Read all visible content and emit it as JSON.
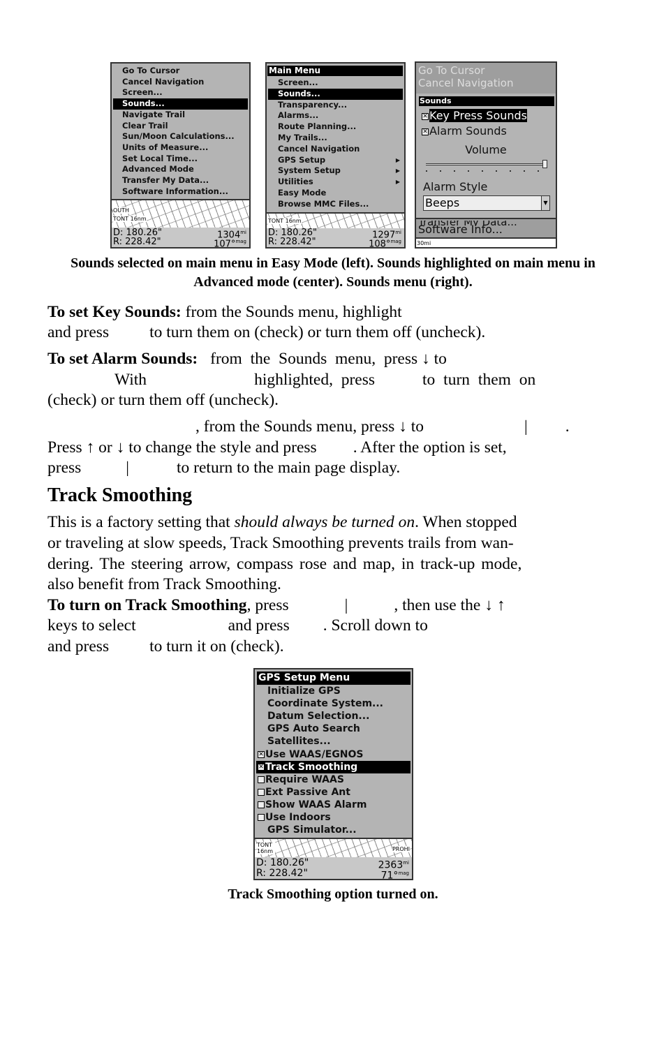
{
  "screen_easy": {
    "items": [
      "Go To Cursor",
      "Cancel Navigation",
      "Screen...",
      "Sounds...",
      "Navigate Trail",
      "Clear Trail",
      "Sun/Moon Calculations...",
      "Units of Measure...",
      "Set Local Time...",
      "Advanced Mode",
      "Transfer My Data...",
      "Software Information..."
    ],
    "selected": "Sounds...",
    "map_labels": [
      "OUTH",
      "TONT 16nm"
    ],
    "d": "D:  180.26\"",
    "r": "R:  228.42\"",
    "dist": "1304",
    "dist_unit": "mi",
    "bearing": "107°",
    "bearing_unit": "mag"
  },
  "screen_adv": {
    "title": "Main Menu",
    "items": [
      {
        "label": "Screen..."
      },
      {
        "label": "Sounds..."
      },
      {
        "label": "Transparency..."
      },
      {
        "label": "Alarms..."
      },
      {
        "label": "Route Planning..."
      },
      {
        "label": "My Trails..."
      },
      {
        "label": "Cancel Navigation"
      },
      {
        "label": "GPS Setup",
        "arrow": true
      },
      {
        "label": "System Setup",
        "arrow": true
      },
      {
        "label": "Utilities",
        "arrow": true
      },
      {
        "label": "Easy Mode"
      },
      {
        "label": "Browse MMC Files..."
      }
    ],
    "selected": "Sounds...",
    "map_labels": [
      "TONT 16nm"
    ],
    "d": "D:  180.26\"",
    "r": "R:  228.42\"",
    "dist": "1297",
    "dist_unit": "mi",
    "bearing": "108°",
    "bearing_unit": "mag"
  },
  "screen_sounds": {
    "bg_items": [
      "Go To Cursor",
      "Cancel Navigation"
    ],
    "title": "Sounds",
    "key_press": "Key Press Sounds",
    "key_press_checked": true,
    "alarm_sounds": "Alarm Sounds",
    "alarm_sounds_checked": true,
    "volume_label": "Volume",
    "volume_level": 1.0,
    "alarm_style_label": "Alarm Style",
    "alarm_style_value": "Beeps",
    "bg_items_below": [
      "Transfer My Data...",
      "Software Info..."
    ],
    "scale": "30mi"
  },
  "caption1": "Sounds selected on main menu in Easy Mode (left). Sounds highlighted on main menu in Advanced mode (center). Sounds menu (right).",
  "p1": {
    "b": "To set Key Sounds:",
    "t1": " from the Sounds menu, highlight",
    "t2": "and press",
    "t3": "to turn them on (check) or turn them off (uncheck)."
  },
  "p2": {
    "b": "To set Alarm Sounds:",
    "t1": "from",
    "t1b": "the",
    "t1c": "Sounds",
    "t1d": "menu,",
    "t1e": "press ↓ to",
    "t2a": "With",
    "t2b": "highlighted,",
    "t2c": "press",
    "t2d": "to turn them on",
    "t3": "(check) or turn them off (uncheck)."
  },
  "p3": {
    "t1a": ", from the Sounds menu, press ↓ to",
    "t1b": "|",
    "t1c": ".",
    "t2": "Press ↑ or ↓ to change the style and press",
    "t2b": ". After the option is set,",
    "t3a": "press",
    "t3b": "|",
    "t3c": "to return to the main page display."
  },
  "heading": "Track Smoothing",
  "p4": {
    "l1a": "This is a factory setting that ",
    "l1i": "should always be turned on",
    "l1b": ". When stopped",
    "l2": "or traveling at slow speeds, Track Smoothing prevents trails from wan-",
    "l3": "dering. The steering arrow, compass rose and map, in track-up mode,",
    "l4": "also benefit from Track Smoothing."
  },
  "p5": {
    "b": "To turn on Track Smoothing",
    "t1": ", press",
    "t1b": "|",
    "t1c": ", then use the ↓ ↑",
    "t2a": "keys to select",
    "t2b": "and press",
    "t2c": ". Scroll down to",
    "t3a": "and press",
    "t3b": "to turn it on (check)."
  },
  "screen_gps": {
    "title": "GPS Setup Menu",
    "items": [
      {
        "label": "Initialize GPS"
      },
      {
        "label": "Coordinate System..."
      },
      {
        "label": "Datum Selection..."
      },
      {
        "label": "GPS Auto Search"
      },
      {
        "label": "Satellites..."
      },
      {
        "label": "Use WAAS/EGNOS",
        "checked": true
      },
      {
        "label": "Track Smoothing",
        "checked": true
      },
      {
        "label": "Require WAAS",
        "checked": false
      },
      {
        "label": "Ext Passive Ant",
        "checked": false
      },
      {
        "label": "Show WAAS Alarm",
        "checked": false
      },
      {
        "label": "Use Indoors",
        "checked": false
      },
      {
        "label": "GPS Simulator..."
      }
    ],
    "selected": "Track Smoothing",
    "map_labels": [
      "TONT 16nm",
      "PROHI"
    ],
    "d": "D:  180.26\"",
    "r": "R:  228.42\"",
    "dist": "2363",
    "dist_unit": "mi",
    "bearing": "71°",
    "bearing_unit": "mag"
  },
  "caption2": "Track Smoothing option turned on."
}
